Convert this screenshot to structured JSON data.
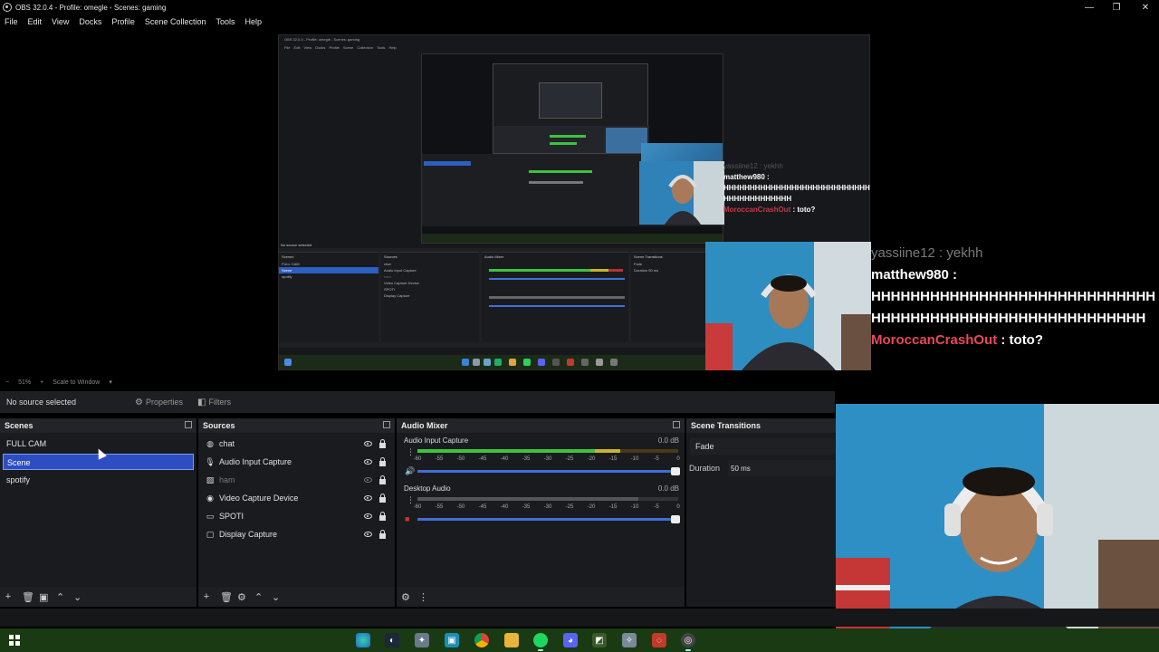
{
  "window": {
    "title": "OBS 32.0.4 - Profile: omegle - Scenes: gaming",
    "controls": [
      "—",
      "❐",
      "✕"
    ]
  },
  "menu": [
    "File",
    "Edit",
    "View",
    "Docks",
    "Profile",
    "Scene Collection",
    "Tools",
    "Help"
  ],
  "zoom": {
    "minus": "−",
    "value": "51%",
    "plus": "+",
    "mode": "Scale to Window"
  },
  "source_bar": {
    "no_source": "No source selected",
    "properties": "Properties",
    "filters": "Filters"
  },
  "scenes": {
    "title": "Scenes",
    "items": [
      {
        "label": "FULL CAM",
        "selected": false
      },
      {
        "label": "Scene",
        "selected": true
      },
      {
        "label": "spotify",
        "selected": false
      }
    ]
  },
  "sources": {
    "title": "Sources",
    "items": [
      {
        "label": "chat",
        "icon": "browser-icon",
        "visible": true
      },
      {
        "label": "Audio Input Capture",
        "icon": "microphone-icon",
        "visible": true
      },
      {
        "label": "ham",
        "icon": "image-icon",
        "visible": false
      },
      {
        "label": "Video Capture Device",
        "icon": "camera-icon",
        "visible": true
      },
      {
        "label": "SPOTI",
        "icon": "window-icon",
        "visible": true
      },
      {
        "label": "Display Capture",
        "icon": "monitor-icon",
        "visible": true
      }
    ]
  },
  "mixer": {
    "title": "Audio Mixer",
    "channels": [
      {
        "name": "Audio Input Capture",
        "db": "0.0 dB"
      },
      {
        "name": "Desktop Audio",
        "db": "0.0 dB"
      }
    ],
    "scale": [
      "-60",
      "-55",
      "-50",
      "-45",
      "-40",
      "-35",
      "-30",
      "-25",
      "-20",
      "-15",
      "-10",
      "-5",
      "0"
    ]
  },
  "transitions": {
    "title": "Scene Transitions",
    "selected": "Fade",
    "duration_label": "Duration",
    "duration_value": "50 ms"
  },
  "chat_overlay": {
    "faded_line": "yassiine12 : yekhh",
    "user1": "matthew980 :",
    "message1": "HHHHHHHHHHHHHHHHHHHHHHHHHHHHHHHHHHHHHHHHHHHHHHHHHHHHHHHHH",
    "user2": "MoroccanCrashOut",
    "message2": " : toto?"
  },
  "chat_small": {
    "faded_line": "yassiine12 : yekhh",
    "user1": "matthew980 :",
    "message1": "HHHHHHHHHHHHHHHHHHHHHHHHHHHHHHHHHHHHHHHHH",
    "user2": "MoroccanCrashOut",
    "message2": " : toto?"
  },
  "inner_obs": {
    "title": "OBS 32.0.4 - Profile: omegle - Scenes: gaming",
    "menu": "File Edit View Docks Profile Scene Collection Tools Help",
    "panels": [
      "Scenes",
      "Sources",
      "Audio Mixer",
      "Scene Transitions"
    ],
    "scenes": [
      "FULL CAM",
      "Scene",
      "spotify"
    ],
    "sources": [
      "chat",
      "Audio Input Capture",
      "ham",
      "Video Capture Device",
      "SPOTI",
      "Display Capture"
    ],
    "no_source": "No source selected",
    "transition": "Fade",
    "duration": "Duration",
    "duration_value": "50 ms"
  },
  "colors": {
    "accent": "#2c4ec0",
    "meter_green": "#3dc33d",
    "meter_yellow": "#c9b42b",
    "meter_red": "#b83232",
    "taskbar": "#1a3a14"
  }
}
